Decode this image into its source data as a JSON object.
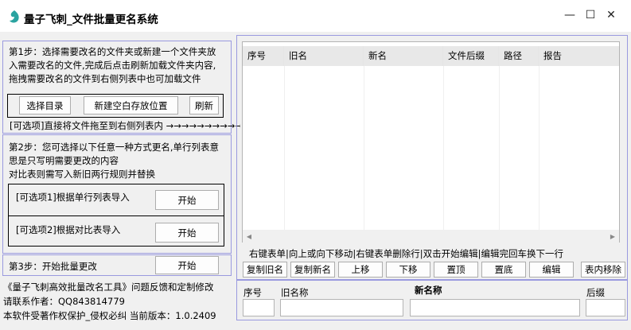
{
  "window": {
    "title": "量子飞刺_文件批量更名系统",
    "minimize_glyph": "—",
    "maximize_glyph": "☐",
    "close_glyph": "✕"
  },
  "step1": {
    "desc": [
      "第1步：选择需要改名的文件夹或新建一个文件夹放",
      "入需要改名的文件,完成后点击刷新加载文件夹内容,",
      "拖拽需要改名的文件到右侧列表中也可加载文件"
    ],
    "select_dir": "选择目录",
    "new_folder": "新建空白存放位置",
    "refresh": "刷新",
    "drag_hint": "[可选项]直接将文件拖至到右侧列表内 →→→→→→→→→→→"
  },
  "step2": {
    "desc": [
      "第2步：您可选择以下任意一种方式更名,单行列表意",
      "思是只写明需要更改的内容",
      "对比表则需写入新旧两行规则并替换"
    ],
    "option1_label": "[可选项1]根据单行列表导入",
    "option1_btn": "开始",
    "option2_label": "[可选项2]根据对比表导入",
    "option2_btn": "开始"
  },
  "step3": {
    "label": "第3步：开始批量更改",
    "btn": "开始"
  },
  "footer": {
    "line1": "《量子飞刺高效批量改名工具》问题反馈和定制修改",
    "line2": "请联系作者：QQ843814779",
    "line3": "本软件受著作权保护_侵权必纠 当前版本：1.0.2409"
  },
  "table": {
    "columns": [
      "序号",
      "旧名",
      "新名",
      "文件后缀",
      "路径",
      "报告"
    ]
  },
  "hint": "右键表单|向上或向下移动|右键表单删除行|双击开始编辑|编辑完回车换下一行",
  "actions": [
    "复制旧名",
    "复制新名",
    "上移",
    "下移",
    "置顶",
    "置底",
    "编辑",
    "表内移除"
  ],
  "editor": {
    "seq_label": "序号",
    "old_label": "旧名称",
    "new_label": "新名称",
    "ext_label": "后缀",
    "seq_value": "",
    "old_value": "",
    "new_value": "",
    "ext_value": ""
  },
  "colors": {
    "panel_border": "#9a9adf",
    "icon": "#2aa3a0"
  }
}
